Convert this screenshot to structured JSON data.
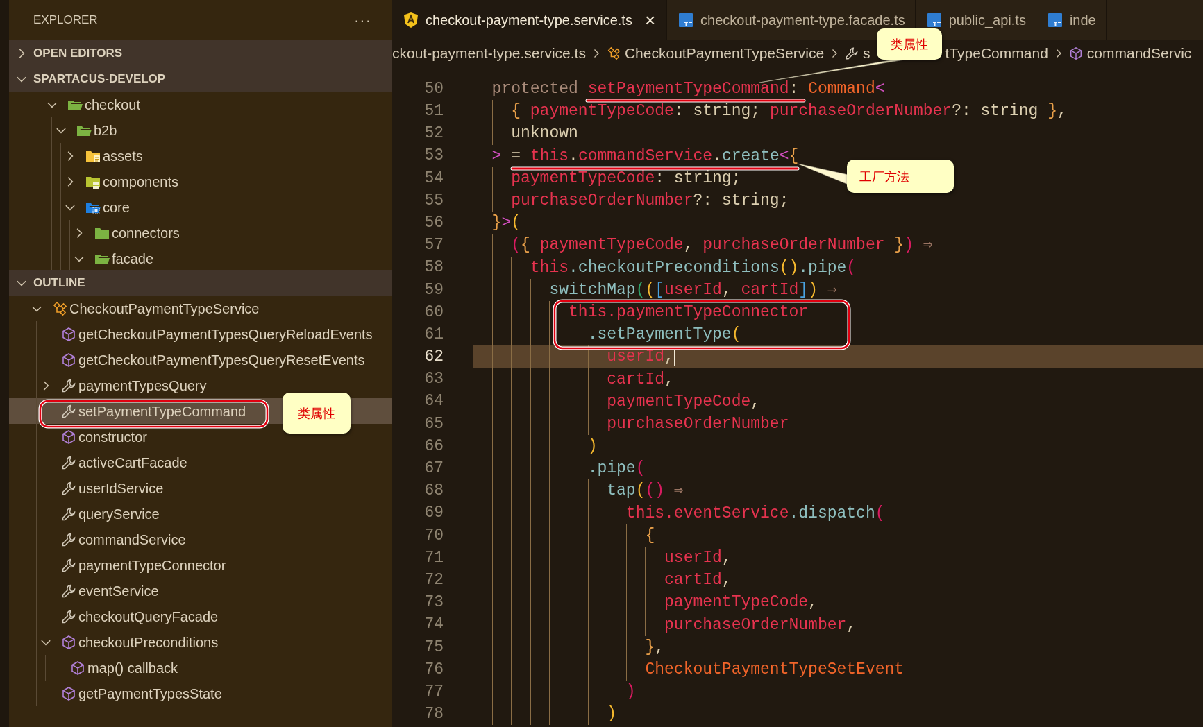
{
  "sidebar": {
    "title": "EXPLORER",
    "more": "···",
    "sections": [
      {
        "title": "OPEN EDITORS",
        "expanded": false
      },
      {
        "title": "SPARTACUS-DEVELOP",
        "expanded": true
      }
    ],
    "tree": [
      {
        "label": "checkout",
        "kind": "folder",
        "expanded": true,
        "children": [
          {
            "label": "b2b",
            "kind": "folder",
            "expanded": true,
            "children": [
              {
                "label": "assets",
                "kind": "assets",
                "expanded": false
              },
              {
                "label": "components",
                "kind": "components",
                "expanded": false
              },
              {
                "label": "core",
                "kind": "core",
                "expanded": true,
                "children": [
                  {
                    "label": "connectors",
                    "kind": "folder",
                    "expanded": false
                  },
                  {
                    "label": "facade",
                    "kind": "folder",
                    "expanded": true
                  }
                ]
              }
            ]
          }
        ]
      }
    ],
    "outline": {
      "title": "OUTLINE",
      "expanded": true,
      "items": [
        {
          "label": "CheckoutPaymentTypeService",
          "kind": "class",
          "expanded": true,
          "selected": false,
          "children": [
            {
              "label": "getCheckoutPaymentTypesQueryReloadEvents",
              "kind": "method",
              "selected": false
            },
            {
              "label": "getCheckoutPaymentTypesQueryResetEvents",
              "kind": "method",
              "selected": false
            },
            {
              "label": "paymentTypesQuery",
              "kind": "property",
              "expanded": false,
              "selected": false
            },
            {
              "label": "setPaymentTypeCommand",
              "kind": "property",
              "selected": true
            },
            {
              "label": "constructor",
              "kind": "method",
              "selected": false
            },
            {
              "label": "activeCartFacade",
              "kind": "property",
              "selected": false
            },
            {
              "label": "userIdService",
              "kind": "property",
              "selected": false
            },
            {
              "label": "queryService",
              "kind": "property",
              "selected": false
            },
            {
              "label": "commandService",
              "kind": "property",
              "selected": false
            },
            {
              "label": "paymentTypeConnector",
              "kind": "property",
              "selected": false
            },
            {
              "label": "eventService",
              "kind": "property",
              "selected": false
            },
            {
              "label": "checkoutQueryFacade",
              "kind": "property",
              "selected": false
            },
            {
              "label": "checkoutPreconditions",
              "kind": "method",
              "expanded": true,
              "selected": false,
              "children": [
                {
                  "label": "map() callback",
                  "kind": "method",
                  "selected": false
                }
              ]
            },
            {
              "label": "getPaymentTypesState",
              "kind": "method",
              "selected": false
            }
          ]
        }
      ]
    }
  },
  "editor": {
    "tabs": [
      {
        "label": "checkout-payment-type.service.ts",
        "kind": "angular",
        "selected": true,
        "close": "×"
      },
      {
        "label": "checkout-payment-type.facade.ts",
        "kind": "ts",
        "selected": false
      },
      {
        "label": "public_api.ts",
        "kind": "ts",
        "selected": false
      },
      {
        "label": "inde",
        "kind": "ts",
        "selected": false
      }
    ],
    "breadcrumb": [
      {
        "kind": "file",
        "text": "ckout-payment-type.service.ts"
      },
      {
        "kind": "class",
        "text": "CheckoutPaymentTypeService"
      },
      {
        "kind": "property",
        "text_start": "s",
        "text_end": "tTypeCommand"
      },
      {
        "kind": "method",
        "text": "commandServic"
      }
    ],
    "lines": [
      {
        "number": "50",
        "current": false,
        "tokens": [
          {
            "kind": "keyword",
            "text": "  protected "
          },
          {
            "kind": "variable",
            "text": "setPaymentTypeCommand"
          },
          {
            "kind": "plain",
            "text": ": "
          },
          {
            "kind": "type",
            "text": "Command"
          },
          {
            "kind": "pink",
            "text": "<"
          }
        ]
      },
      {
        "number": "51",
        "current": false,
        "tokens": [
          {
            "kind": "orange",
            "text": "    {"
          },
          {
            "kind": "variable",
            "text": " paymentTypeCode"
          },
          {
            "kind": "plain",
            "text": ": string; "
          },
          {
            "kind": "variable",
            "text": "purchaseOrderNumber"
          },
          {
            "kind": "plain",
            "text": "?: string "
          },
          {
            "kind": "orange",
            "text": "}"
          },
          {
            "kind": "plain",
            "text": ","
          }
        ]
      },
      {
        "number": "52",
        "current": false,
        "tokens": [
          {
            "kind": "plain",
            "text": "    unknown"
          }
        ]
      },
      {
        "number": "53",
        "current": false,
        "tokens": [
          {
            "kind": "pink",
            "text": "  >"
          },
          {
            "kind": "plain",
            "text": " = "
          },
          {
            "kind": "variable",
            "text": "this"
          },
          {
            "kind": "plain",
            "text": "."
          },
          {
            "kind": "variable",
            "text": "commandService"
          },
          {
            "kind": "plain",
            "text": "."
          },
          {
            "kind": "function",
            "text": "create"
          },
          {
            "kind": "pink",
            "text": "<"
          },
          {
            "kind": "orange",
            "text": "{"
          }
        ]
      },
      {
        "number": "54",
        "current": false,
        "tokens": [
          {
            "kind": "variable",
            "text": "    paymentTypeCode"
          },
          {
            "kind": "plain",
            "text": ": string;"
          }
        ]
      },
      {
        "number": "55",
        "current": false,
        "tokens": [
          {
            "kind": "variable",
            "text": "    purchaseOrderNumber"
          },
          {
            "kind": "plain",
            "text": "?: string;"
          }
        ]
      },
      {
        "number": "56",
        "current": false,
        "tokens": [
          {
            "kind": "orange",
            "text": "  }"
          },
          {
            "kind": "pink",
            "text": ">"
          },
          {
            "kind": "yellow",
            "text": "("
          }
        ]
      },
      {
        "number": "57",
        "current": false,
        "tokens": [
          {
            "kind": "magenta",
            "text": "    ("
          },
          {
            "kind": "orange",
            "text": "{"
          },
          {
            "kind": "variable",
            "text": " paymentTypeCode"
          },
          {
            "kind": "plain",
            "text": ", "
          },
          {
            "kind": "variable",
            "text": "purchaseOrderNumber"
          },
          {
            "kind": "orange",
            "text": " }"
          },
          {
            "kind": "magenta",
            "text": ")"
          },
          {
            "kind": "arrow",
            "text": " ⇒"
          }
        ]
      },
      {
        "number": "58",
        "current": false,
        "tokens": [
          {
            "kind": "variable",
            "text": "      this"
          },
          {
            "kind": "function",
            "text": ".checkoutPreconditions"
          },
          {
            "kind": "yellow",
            "text": "()"
          },
          {
            "kind": "function",
            "text": ".pipe"
          },
          {
            "kind": "magenta",
            "text": "("
          }
        ]
      },
      {
        "number": "59",
        "current": false,
        "tokens": [
          {
            "kind": "function",
            "text": "        switchMap"
          },
          {
            "kind": "green",
            "text": "("
          },
          {
            "kind": "yellow",
            "text": "("
          },
          {
            "kind": "blue",
            "text": "["
          },
          {
            "kind": "variable",
            "text": "userId"
          },
          {
            "kind": "plain",
            "text": ", "
          },
          {
            "kind": "variable",
            "text": "cartId"
          },
          {
            "kind": "blue",
            "text": "]"
          },
          {
            "kind": "yellow",
            "text": ")"
          },
          {
            "kind": "arrow",
            "text": " ⇒"
          }
        ]
      },
      {
        "number": "60",
        "current": false,
        "tokens": [
          {
            "kind": "variable",
            "text": "          this"
          },
          {
            "kind": "variable",
            "text": ".paymentTypeConnector"
          }
        ]
      },
      {
        "number": "61",
        "current": false,
        "tokens": [
          {
            "kind": "function",
            "text": "            .setPaymentType"
          },
          {
            "kind": "yellow",
            "text": "("
          }
        ]
      },
      {
        "number": "62",
        "current": true,
        "tokens": [
          {
            "kind": "variable",
            "text": "              userId"
          },
          {
            "kind": "plain",
            "text": ","
          }
        ]
      },
      {
        "number": "63",
        "current": false,
        "tokens": [
          {
            "kind": "variable",
            "text": "              cartId"
          },
          {
            "kind": "plain",
            "text": ","
          }
        ]
      },
      {
        "number": "64",
        "current": false,
        "tokens": [
          {
            "kind": "variable",
            "text": "              paymentTypeCode"
          },
          {
            "kind": "plain",
            "text": ","
          }
        ]
      },
      {
        "number": "65",
        "current": false,
        "tokens": [
          {
            "kind": "variable",
            "text": "              purchaseOrderNumber"
          }
        ]
      },
      {
        "number": "66",
        "current": false,
        "tokens": [
          {
            "kind": "yellow",
            "text": "            )"
          }
        ]
      },
      {
        "number": "67",
        "current": false,
        "tokens": [
          {
            "kind": "function",
            "text": "            .pipe"
          },
          {
            "kind": "magenta",
            "text": "("
          }
        ]
      },
      {
        "number": "68",
        "current": false,
        "tokens": [
          {
            "kind": "function",
            "text": "              tap"
          },
          {
            "kind": "yellow",
            "text": "("
          },
          {
            "kind": "magenta",
            "text": "()"
          },
          {
            "kind": "arrow",
            "text": " ⇒"
          }
        ]
      },
      {
        "number": "69",
        "current": false,
        "tokens": [
          {
            "kind": "variable",
            "text": "                this"
          },
          {
            "kind": "variable",
            "text": ".eventService"
          },
          {
            "kind": "function",
            "text": ".dispatch"
          },
          {
            "kind": "magenta",
            "text": "("
          }
        ]
      },
      {
        "number": "70",
        "current": false,
        "tokens": [
          {
            "kind": "orange",
            "text": "                  {"
          }
        ]
      },
      {
        "number": "71",
        "current": false,
        "tokens": [
          {
            "kind": "variable",
            "text": "                    userId"
          },
          {
            "kind": "plain",
            "text": ","
          }
        ]
      },
      {
        "number": "72",
        "current": false,
        "tokens": [
          {
            "kind": "variable",
            "text": "                    cartId"
          },
          {
            "kind": "plain",
            "text": ","
          }
        ]
      },
      {
        "number": "73",
        "current": false,
        "tokens": [
          {
            "kind": "variable",
            "text": "                    paymentTypeCode"
          },
          {
            "kind": "plain",
            "text": ","
          }
        ]
      },
      {
        "number": "74",
        "current": false,
        "tokens": [
          {
            "kind": "variable",
            "text": "                    purchaseOrderNumber"
          },
          {
            "kind": "plain",
            "text": ","
          }
        ]
      },
      {
        "number": "75",
        "current": false,
        "tokens": [
          {
            "kind": "orange",
            "text": "                  }"
          },
          {
            "kind": "plain",
            "text": ","
          }
        ]
      },
      {
        "number": "76",
        "current": false,
        "tokens": [
          {
            "kind": "type",
            "text": "                  CheckoutPaymentTypeSetEvent"
          }
        ]
      },
      {
        "number": "77",
        "current": false,
        "tokens": [
          {
            "kind": "magenta",
            "text": "                )"
          }
        ]
      },
      {
        "number": "78",
        "current": false,
        "tokens": [
          {
            "kind": "yellow",
            "text": "              )"
          }
        ]
      }
    ]
  },
  "annotations": [
    {
      "text": "类属性"
    },
    {
      "text": "工厂方法"
    },
    {
      "text": "类属性"
    }
  ]
}
